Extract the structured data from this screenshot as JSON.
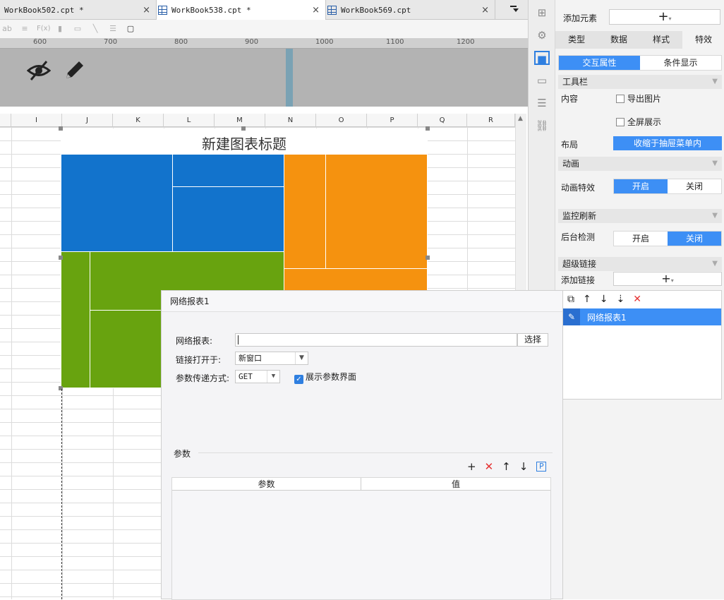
{
  "tabs": [
    {
      "label": "WorkBook502.cpt *",
      "close": "×"
    },
    {
      "label": "WorkBook538.cpt *",
      "close": "×"
    },
    {
      "label": "WorkBook569.cpt",
      "close": "×"
    }
  ],
  "toolbar": {
    "text_tool": "ab",
    "formula_tool": "F(x)"
  },
  "ruler": [
    "600",
    "700",
    "800",
    "900",
    "1000",
    "1100",
    "1200"
  ],
  "columns": [
    "I",
    "J",
    "K",
    "L",
    "M",
    "N",
    "O",
    "P",
    "Q",
    "R"
  ],
  "chart": {
    "title": "新建图表标题",
    "colors": {
      "blue": "#1273cc",
      "orange": "#f5920f",
      "green": "#68a30f"
    }
  },
  "panel": {
    "add_element_label": "添加元素",
    "add_symbol": "+",
    "tabs": [
      "类型",
      "数据",
      "样式",
      "特效"
    ],
    "subtabs": [
      "交互属性",
      "条件显示"
    ],
    "toolbar_section": "工具栏",
    "content_label": "内容",
    "export_image": "导出图片",
    "fullscreen": "全屏展示",
    "layout_label": "布局",
    "layout_value": "收缩于抽屉菜单内",
    "animation_section": "动画",
    "animation_label": "动画特效",
    "animation_on": "开启",
    "animation_off": "关闭",
    "monitor_section": "监控刷新",
    "bg_check_label": "后台检测",
    "bg_on": "开启",
    "bg_off": "关闭",
    "hyperlink_section": "超级链接",
    "add_link_label": "添加链接",
    "link_items": [
      "网络报表1"
    ]
  },
  "dialog": {
    "title": "网络报表1",
    "report_label": "网络报表:",
    "report_value": "",
    "select_button": "选择",
    "open_in_label": "链接打开于:",
    "open_in_value": "新窗口",
    "method_label": "参数传递方式:",
    "method_value": "GET",
    "show_params_label": "展示参数界面",
    "params_section": "参数",
    "param_col": "参数",
    "value_col": "值",
    "param_badge": "P"
  }
}
